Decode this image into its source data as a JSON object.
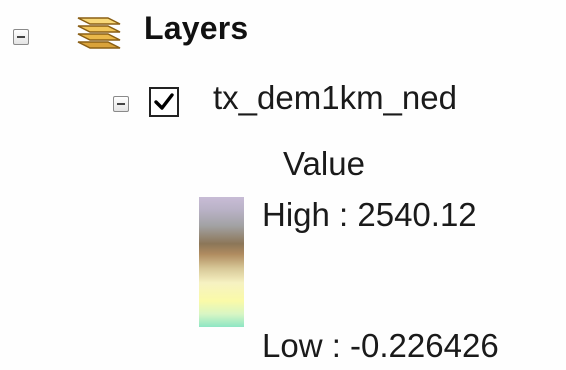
{
  "toc": {
    "root": {
      "label": "Layers",
      "icon": "layers-icon",
      "expanded": true
    },
    "layer": {
      "name": "tx_dem1km_ned",
      "visible": true,
      "expanded": true,
      "legend": {
        "heading": "Value",
        "high_label": "High : 2540.12",
        "low_label": "Low : -0.226426",
        "ramp_colors": [
          "#c8bcd6",
          "#a2a2a4",
          "#8c7658",
          "#d8c898",
          "#f6f2c2",
          "#fafaa8",
          "#8ee6c4"
        ]
      }
    }
  }
}
